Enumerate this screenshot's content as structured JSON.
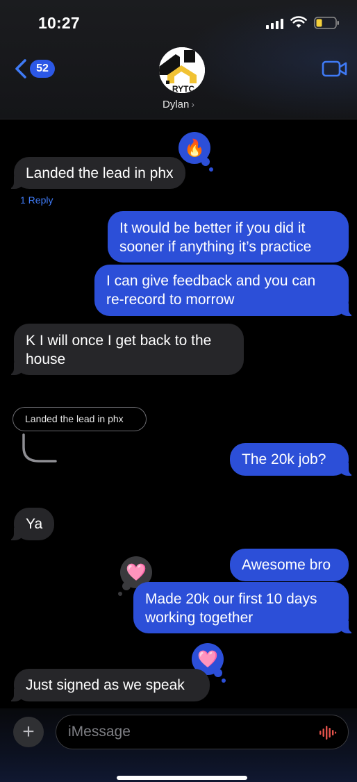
{
  "status_bar": {
    "time": "10:27"
  },
  "header": {
    "back_count": "52",
    "contact_name": "Dylan",
    "name_chevron": "›",
    "avatar_logo_text": "RYTC",
    "icons": {
      "back": "chevron-left-icon",
      "video": "video-camera-icon"
    }
  },
  "messages": [
    {
      "from": "them",
      "text": "Landed the lead in phx",
      "reaction": "🔥",
      "replies": "1 Reply"
    },
    {
      "from": "me",
      "lines": [
        "It would be better if you did it",
        "sooner if anything it’s practice"
      ]
    },
    {
      "from": "me",
      "lines": [
        "I can give feedback and you can",
        "re-record to morrow"
      ]
    },
    {
      "from": "them",
      "lines": [
        "K I will once I get back to the",
        "house"
      ]
    },
    {
      "from": "quote",
      "text": "Landed the lead in phx"
    },
    {
      "from": "me",
      "text": "The 20k job?"
    },
    {
      "from": "them",
      "text": "Ya"
    },
    {
      "from": "me",
      "text": "Awesome bro"
    },
    {
      "from": "me",
      "lines": [
        "Made 20k our first 10 days",
        "working together"
      ],
      "reaction": "🩷"
    },
    {
      "from": "them",
      "text": "Just signed as we speak",
      "reaction": "🩷"
    }
  ],
  "input": {
    "placeholder": "iMessage",
    "plus_label": "+"
  },
  "colors": {
    "sent_bubble": "#2c4fd8",
    "received_bubble": "#262629",
    "accent": "#3f7af5"
  }
}
